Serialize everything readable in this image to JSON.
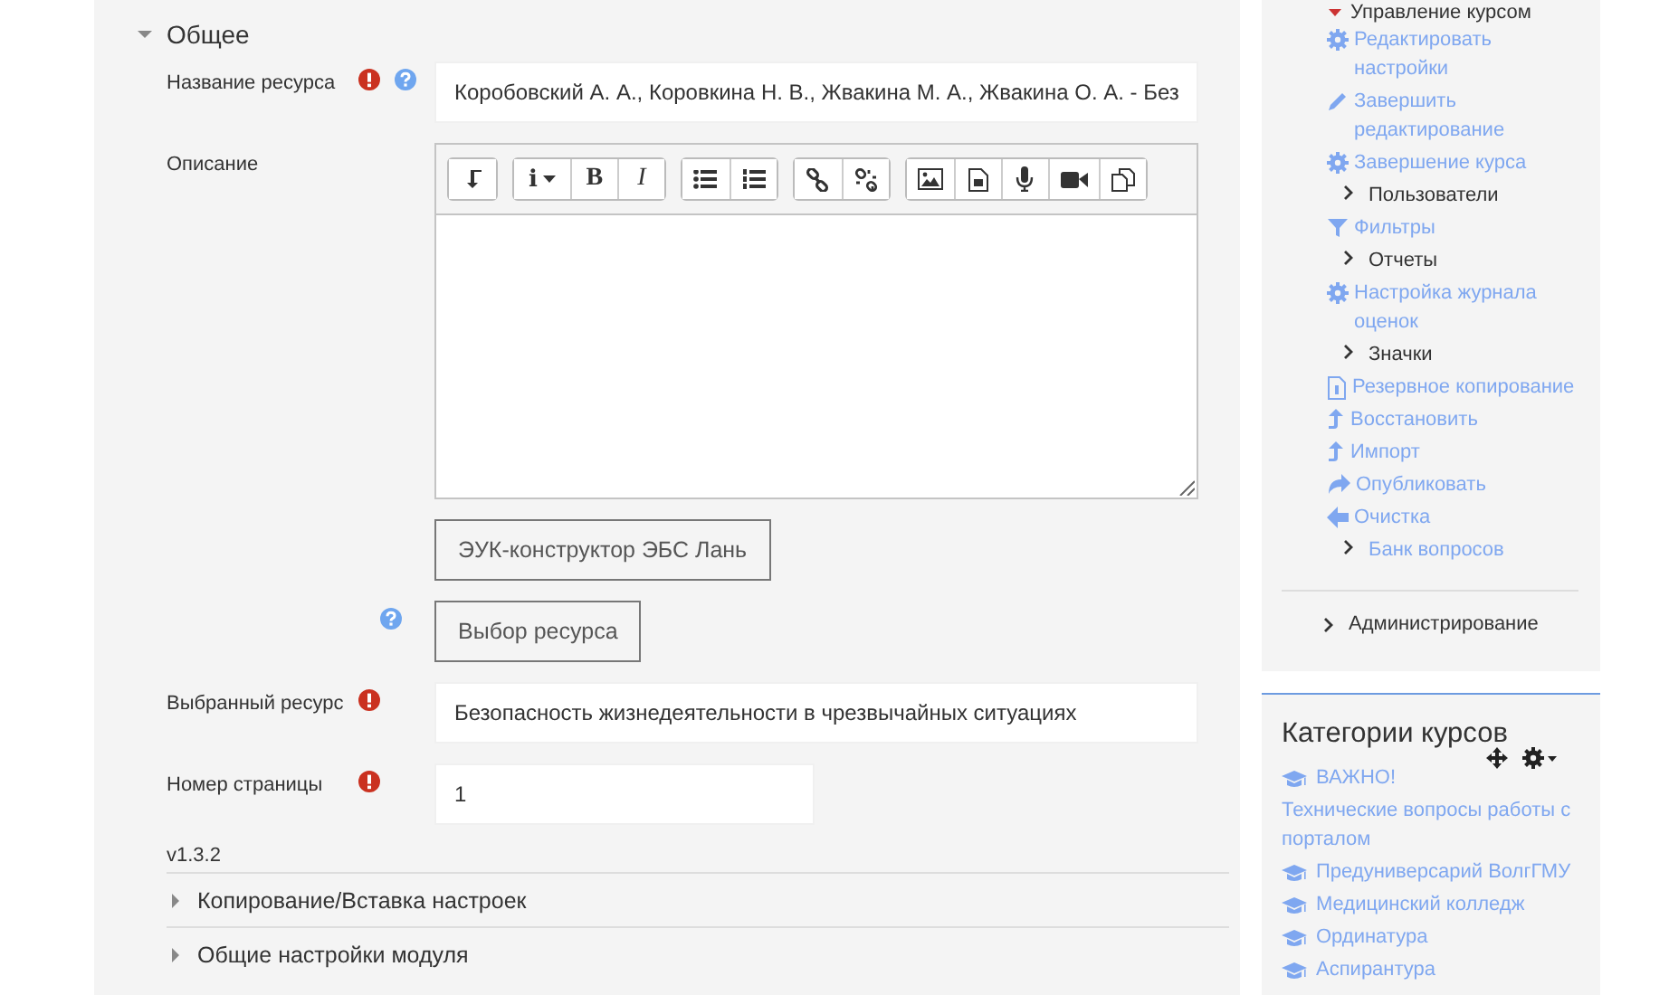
{
  "general": {
    "title": "Общее",
    "expanded": true,
    "fields": [
      {
        "kind": "text",
        "label": "Название ресурса",
        "required": true,
        "help": true,
        "value": "Коробовский А. А., Коровкина Н. В., Жвакина М. А., Жвакина О. А. - Без"
      },
      {
        "kind": "editor",
        "label": "Описание",
        "required": false,
        "help": false,
        "toolbar": [
          [
            {
              "kind": "collapse"
            }
          ],
          [
            {
              "kind": "char",
              "label": "i",
              "dropdown": true
            },
            {
              "kind": "bold",
              "label": "B",
              "dropdown": false
            },
            {
              "kind": "italic",
              "label": "I",
              "dropdown": false
            }
          ],
          [
            {
              "kind": "bullets"
            },
            {
              "kind": "numbers"
            }
          ],
          [
            {
              "kind": "link"
            },
            {
              "kind": "unlink"
            }
          ],
          [
            {
              "kind": "image"
            },
            {
              "kind": "media"
            },
            {
              "kind": "mic"
            },
            {
              "kind": "video"
            },
            {
              "kind": "files"
            }
          ]
        ]
      },
      {
        "kind": "button",
        "required": false,
        "help": false,
        "button": "ЭУК-конструктор ЭБС Лань"
      },
      {
        "kind": "button",
        "required": false,
        "help": true,
        "button": "Выбор ресурса"
      },
      {
        "kind": "text",
        "label": "Выбранный ресурс",
        "required": true,
        "help": false,
        "value": "Безопасность жизнедеятельности в чрезвычайных ситуациях"
      },
      {
        "kind": "short",
        "label": "Номер страницы",
        "required": true,
        "help": false,
        "value": "1"
      }
    ],
    "version": "v1.3.2"
  },
  "sections": [
    {
      "title": "Копирование/Вставка настроек",
      "expanded": false
    },
    {
      "title": "Общие настройки модуля",
      "expanded": false
    }
  ],
  "navigation": {
    "heading": "Управление курсом",
    "expanded": true,
    "items": [
      {
        "kind": "gear",
        "label": "Редактировать настройки"
      },
      {
        "kind": "pencil",
        "label": "Завершить редактирование"
      },
      {
        "kind": "gear",
        "label": "Завершение курса"
      },
      {
        "kind": "node",
        "label": "Пользователи"
      },
      {
        "kind": "filter",
        "label": "Фильтры"
      },
      {
        "kind": "node",
        "label": "Отчеты"
      },
      {
        "kind": "gear",
        "label": "Настройка журнала оценок"
      },
      {
        "kind": "node",
        "label": "Значки"
      },
      {
        "kind": "backup",
        "label": "Резервное копирование"
      },
      {
        "kind": "upload",
        "label": "Восстановить"
      },
      {
        "kind": "upload",
        "label": "Импорт"
      },
      {
        "kind": "share",
        "label": "Опубликовать"
      },
      {
        "kind": "back",
        "label": "Очистка"
      },
      {
        "kind": "nodelink",
        "label": "Банк вопросов"
      }
    ],
    "admin": {
      "kind": "node",
      "label": "Администрирование"
    }
  },
  "categories": {
    "title": "Категории курсов",
    "items": [
      {
        "kind": "category",
        "label": "ВАЖНО!"
      },
      {
        "kind": "note",
        "label": "Технические вопросы работы с порталом"
      },
      {
        "kind": "category",
        "label": "Предуниверсарий ВолгГМУ"
      },
      {
        "kind": "category",
        "label": "Медицинский колледж"
      },
      {
        "kind": "category",
        "label": "Ординатура"
      },
      {
        "kind": "category",
        "label": "Аспирантура"
      }
    ]
  }
}
